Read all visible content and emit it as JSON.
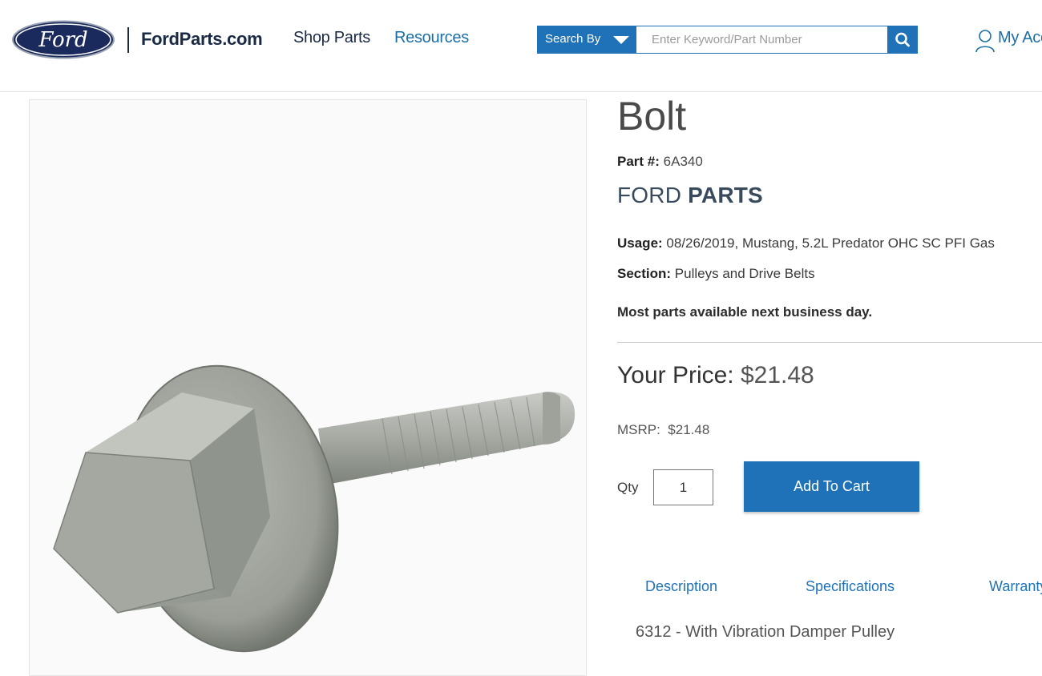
{
  "header": {
    "logo_text": "Ford",
    "site_name": "FordParts.com",
    "nav": {
      "shop_parts": "Shop Parts",
      "resources": "Resources"
    },
    "search": {
      "search_by_label": "Search By",
      "placeholder": "Enter Keyword/Part Number"
    },
    "account_label": "My Account"
  },
  "product": {
    "title": "Bolt",
    "part_label": "Part #:",
    "part_number": "6A340",
    "brand_light": "FORD",
    "brand_bold": "PARTS",
    "usage_label": "Usage:",
    "usage_value": "08/26/2019, Mustang, 5.2L Predator OHC SC PFI Gas",
    "section_label": "Section:",
    "section_value": "Pulleys and Drive Belts",
    "availability": "Most parts available next business day.",
    "price_label": "Your Price:",
    "price_value": "$21.48",
    "msrp_label": "MSRP:",
    "msrp_value": "$21.48",
    "qty_label": "Qty",
    "qty_value": "1",
    "add_to_cart": "Add To Cart"
  },
  "tabs": {
    "description": "Description",
    "specifications": "Specifications",
    "warranty": "Warranty"
  },
  "description_text": "6312 - With Vibration Damper Pulley",
  "colors": {
    "brand_blue": "#1f72b8",
    "ford_navy": "#1b2a44",
    "link_blue": "#1b6fa8"
  }
}
